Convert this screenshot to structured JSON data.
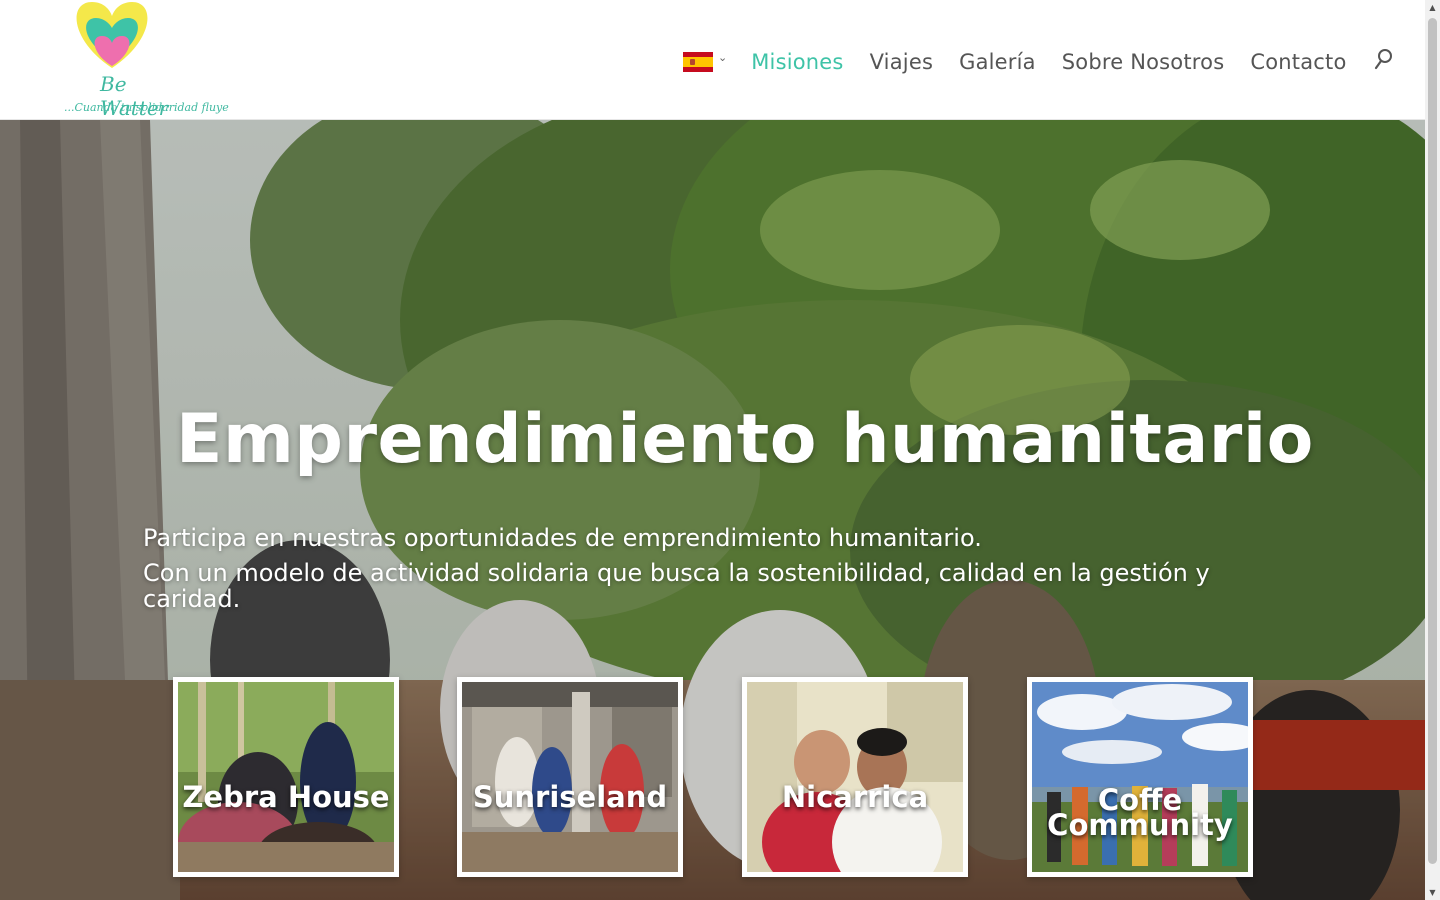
{
  "brand": {
    "name": "Be Watter",
    "tagline": "...Cuando tu solidaridad fluye",
    "colors": {
      "accent": "#3ec3a7",
      "heart_yellow": "#f4e84a",
      "heart_teal": "#3ec3a7",
      "heart_pink": "#ee6fae"
    }
  },
  "nav": {
    "language_flag": "spain-flag-icon",
    "items": [
      {
        "label": "Misiones",
        "active": true
      },
      {
        "label": "Viajes",
        "active": false
      },
      {
        "label": "Galería",
        "active": false
      },
      {
        "label": "Sobre Nosotros",
        "active": false
      },
      {
        "label": "Contacto",
        "active": false
      }
    ],
    "search_icon": "search-icon"
  },
  "hero": {
    "title": "Emprendimiento humanitario",
    "paragraph_1": "Participa en nuestras oportunidades de emprendimiento humanitario.",
    "paragraph_2": "Con un modelo de actividad solidaria que busca la sostenibilidad, calidad en la gestión y caridad."
  },
  "missions": [
    {
      "label": "Zebra House"
    },
    {
      "label": "Sunriseland"
    },
    {
      "label": "Nicarrica"
    },
    {
      "label": "Coffe Community"
    }
  ]
}
